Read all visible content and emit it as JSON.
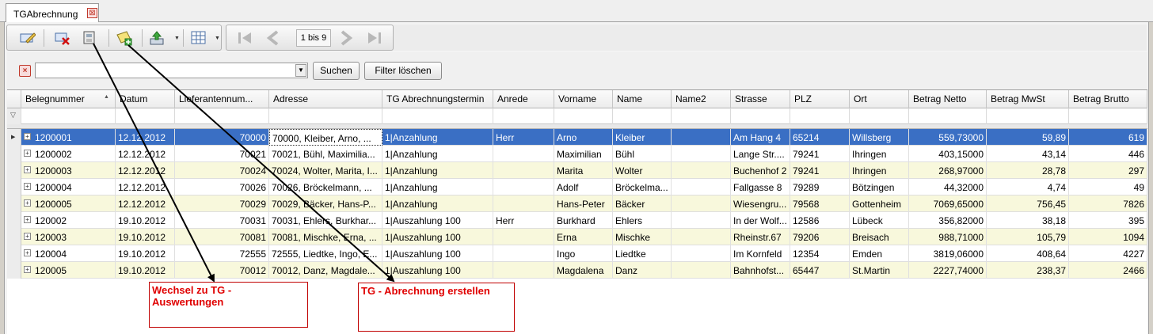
{
  "tab": {
    "title": "TGAbrechnung",
    "close_glyph": "⊠"
  },
  "toolbar": {
    "icons": [
      "edit-icon",
      "delete-icon",
      "switch-evaluation-icon",
      "create-billing-icon",
      "export-icon",
      "grid-layout-icon"
    ],
    "pager": "1 bis 9"
  },
  "filter": {
    "placeholder": "",
    "search_label": "Suchen",
    "clear_label": "Filter löschen"
  },
  "grid": {
    "headers": [
      "Belegnummer",
      "Datum",
      "Lieferantennum...",
      "Adresse",
      "TG Abrechnungstermin",
      "Anrede",
      "Vorname",
      "Name",
      "Name2",
      "Strasse",
      "PLZ",
      "Ort",
      "Betrag Netto",
      "Betrag MwSt",
      "Betrag Brutto"
    ],
    "sort_glyph": "▲",
    "filter_glyph": "▽",
    "rows": [
      [
        "1200001",
        "12.12.2012",
        "70000",
        "70000, Kleiber, Arno, ...",
        "1|Anzahlung",
        "Herr",
        "Arno",
        "Kleiber",
        "",
        "Am Hang 4",
        "65214",
        "Willsberg",
        "559,73000",
        "59,89",
        "619"
      ],
      [
        "1200002",
        "12.12.2012",
        "70021",
        "70021, Bühl, Maximilia...",
        "1|Anzahlung",
        "",
        "Maximilian",
        "Bühl",
        "",
        "Lange Str....",
        "79241",
        "Ihringen",
        "403,15000",
        "43,14",
        "446"
      ],
      [
        "1200003",
        "12.12.2012",
        "70024",
        "70024, Wolter, Marita, I...",
        "1|Anzahlung",
        "",
        "Marita",
        "Wolter",
        "",
        "Buchenhof 2",
        "79241",
        "Ihringen",
        "268,97000",
        "28,78",
        "297"
      ],
      [
        "1200004",
        "12.12.2012",
        "70026",
        "70026, Bröckelmann, ...",
        "1|Anzahlung",
        "",
        "Adolf",
        "Bröckelma...",
        "",
        "Fallgasse 8",
        "79289",
        "Bötzingen",
        "44,32000",
        "4,74",
        "49"
      ],
      [
        "1200005",
        "12.12.2012",
        "70029",
        "70029, Bäcker, Hans-P...",
        "1|Anzahlung",
        "",
        "Hans-Peter",
        "Bäcker",
        "",
        "Wiesengru...",
        "79568",
        "Gottenheim",
        "7069,65000",
        "756,45",
        "7826"
      ],
      [
        "120002",
        "19.10.2012",
        "70031",
        "70031, Ehlers, Burkhar...",
        "1|Auszahlung 100",
        "Herr",
        "Burkhard",
        "Ehlers",
        "",
        "In der Wolf...",
        "12586",
        "Lübeck",
        "356,82000",
        "38,18",
        "395"
      ],
      [
        "120003",
        "19.10.2012",
        "70081",
        "70081, Mischke, Erna, ...",
        "1|Auszahlung 100",
        "",
        "Erna",
        "Mischke",
        "",
        "Rheinstr.67",
        "79206",
        "Breisach",
        "988,71000",
        "105,79",
        "1094"
      ],
      [
        "120004",
        "19.10.2012",
        "72555",
        "72555, Liedtke, Ingo, E...",
        "1|Auszahlung 100",
        "",
        "Ingo",
        "Liedtke",
        "",
        "Im Kornfeld",
        "12354",
        "Emden",
        "3819,06000",
        "408,64",
        "4227"
      ],
      [
        "120005",
        "19.10.2012",
        "70012",
        "70012, Danz, Magdale...",
        "1|Auszahlung 100",
        "",
        "Magdalena",
        "Danz",
        "",
        "Bahnhofst...",
        "65447",
        "St.Martin",
        "2227,74000",
        "238,37",
        "2466"
      ]
    ]
  },
  "callouts": {
    "left": "Wechsel zu TG - Auswertungen",
    "right": "TG - Abrechnung erstellen"
  },
  "colors": {
    "selection": "#3a6fc4",
    "alt_row": "#f8f8dc",
    "callout": "#e00000"
  }
}
